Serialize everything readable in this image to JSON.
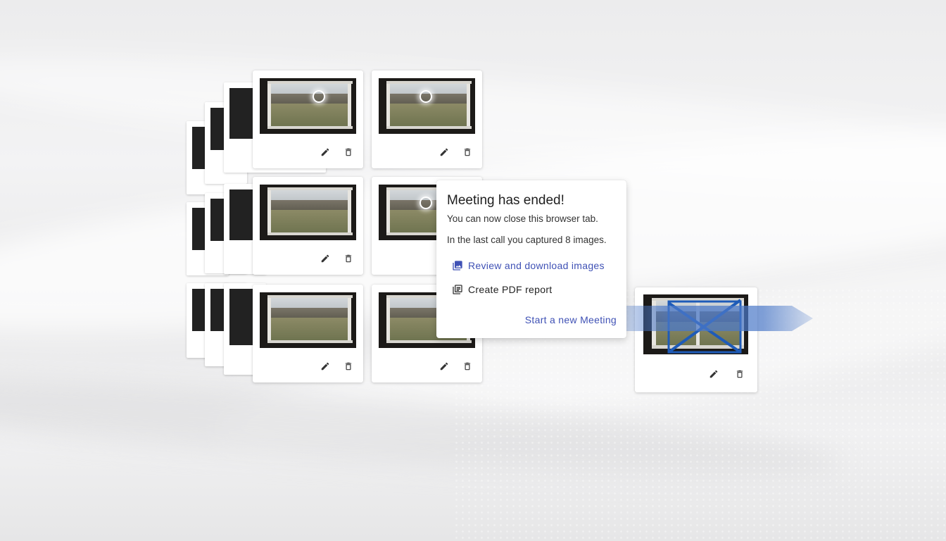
{
  "dialog": {
    "title": "Meeting has ended!",
    "subtitle": "You can now close this browser tab.",
    "note": "In the last call you captured 8 images.",
    "review_label": "Review and download images",
    "pdf_label": "Create PDF report",
    "start_label": "Start a new Meeting"
  },
  "icons": {
    "edit": "pencil-icon",
    "delete": "trash-icon",
    "review": "image-gallery-icon",
    "pdf": "document-stack-icon"
  },
  "colors": {
    "accent": "#3f51b5",
    "arrow": "#4a78c8",
    "cross": "#1e5bb8"
  }
}
